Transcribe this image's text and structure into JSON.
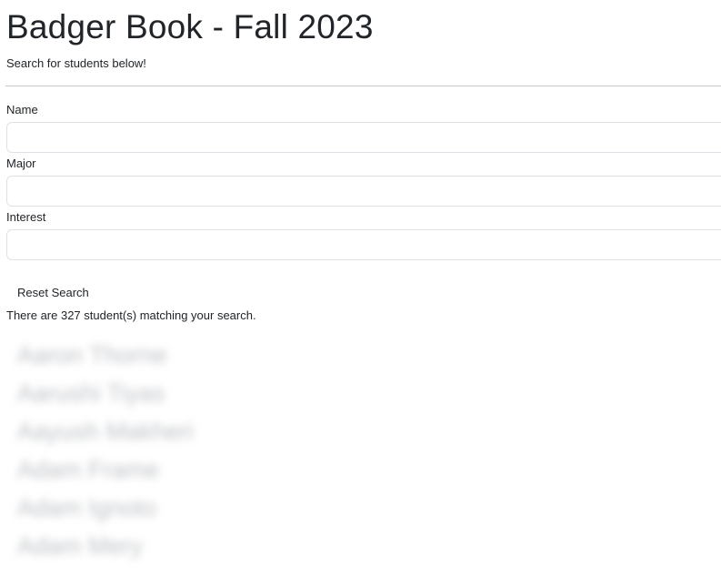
{
  "header": {
    "title": "Badger Book - Fall 2023",
    "subtitle": "Search for students below!"
  },
  "search": {
    "name_label": "Name",
    "name_value": "",
    "major_label": "Major",
    "major_value": "",
    "interest_label": "Interest",
    "interest_value": "",
    "reset_label": "Reset Search"
  },
  "results": {
    "summary": "There are 327 student(s) matching your search.",
    "students": [
      "Aaron Thorne",
      "Aarushi Tiyas",
      "Aayush Makheri",
      "Adam Frame",
      "Adam Ignoto",
      "Adam Mery"
    ]
  }
}
